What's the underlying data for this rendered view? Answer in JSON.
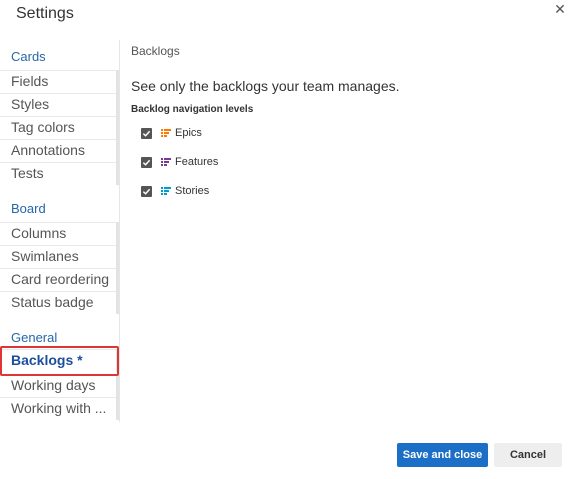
{
  "dialog": {
    "title": "Settings",
    "close_label": "✕"
  },
  "sidebar": {
    "sections": [
      {
        "label": "Cards",
        "items": [
          "Fields",
          "Styles",
          "Tag colors",
          "Annotations",
          "Tests"
        ]
      },
      {
        "label": "Board",
        "items": [
          "Columns",
          "Swimlanes",
          "Card reordering",
          "Status badge"
        ]
      },
      {
        "label": "General",
        "items": [
          "Backlogs *",
          "Working days",
          "Working with ..."
        ]
      }
    ],
    "selected_item": "Backlogs *"
  },
  "main": {
    "heading": "Backlogs",
    "description": "See only the backlogs your team manages.",
    "subheading": "Backlog navigation levels",
    "levels": [
      {
        "label": "Epics",
        "checked": true,
        "icon": "backlog-epics-icon",
        "color": "#ff7b00"
      },
      {
        "label": "Features",
        "checked": true,
        "icon": "backlog-features-icon",
        "color": "#773b93"
      },
      {
        "label": "Stories",
        "checked": true,
        "icon": "backlog-stories-icon",
        "color": "#009ccc"
      }
    ]
  },
  "footer": {
    "save_label": "Save and close",
    "cancel_label": "Cancel"
  },
  "colors": {
    "accent": "#1c6fc7",
    "section_heading": "#2667a9",
    "selected_text": "#1d4e9e",
    "highlight_outline": "#e03535"
  }
}
